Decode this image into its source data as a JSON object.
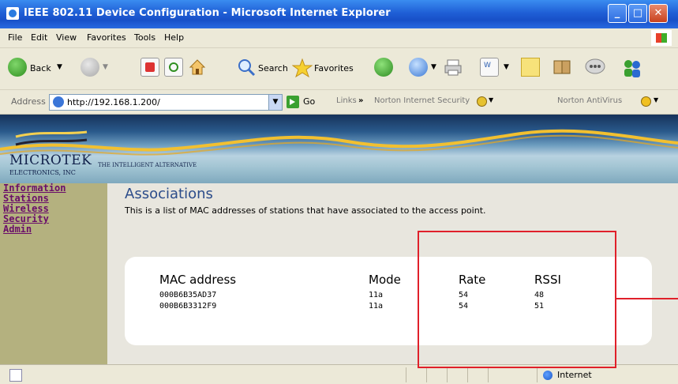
{
  "window": {
    "title": "IEEE 802.11 Device Configuration - Microsoft Internet Explorer"
  },
  "menu": {
    "items": [
      "File",
      "Edit",
      "View",
      "Favorites",
      "Tools",
      "Help"
    ]
  },
  "toolbar": {
    "back_label": "Back",
    "search_label": "Search",
    "favorites_label": "Favorites"
  },
  "address_bar": {
    "label": "Address",
    "url": "http://192.168.1.200/",
    "go_label": "Go",
    "links_label": "Links",
    "links_chevron": "»",
    "norton_security": "Norton Internet Security",
    "norton_antivirus": "Norton AntiVirus"
  },
  "banner": {
    "logo": "MICROTEK",
    "logo_sub": "ELECTRONICS, INC",
    "tagline": "THE INTELLIGENT ALTERNATIVE"
  },
  "sidebar": {
    "items": [
      "Information",
      "Stations",
      "Wireless",
      "Security",
      "Admin"
    ]
  },
  "page": {
    "heading": "Associations",
    "description": "This is a list of MAC addresses of stations that have associated to the access point."
  },
  "table": {
    "headers": [
      "MAC address",
      "Mode",
      "Rate",
      "RSSI"
    ],
    "rows": [
      [
        "000B6B35AD37",
        "11a",
        "54",
        "48"
      ],
      [
        "000B6B3312F9",
        "11a",
        "54",
        "51"
      ]
    ]
  },
  "status": {
    "zone": "Internet"
  },
  "colors": {
    "titlebar": "#1F5FD6",
    "sidebar_bg": "#B4B17F",
    "sidebar_link": "#6A0D6A",
    "heading": "#2B4C8A",
    "annotation": "#E0202A"
  }
}
